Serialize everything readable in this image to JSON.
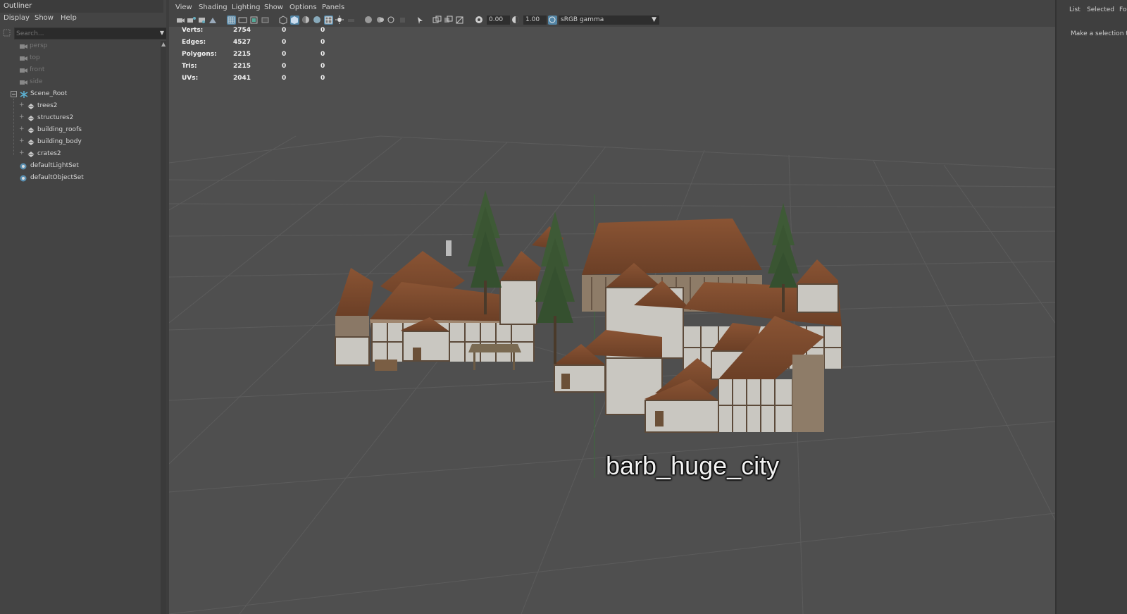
{
  "outliner": {
    "title": "Outliner",
    "menu": [
      "Display",
      "Show",
      "Help"
    ],
    "search_placeholder": "Search...",
    "items": [
      {
        "label": "persp",
        "icon": "camera-icon",
        "dim": true
      },
      {
        "label": "top",
        "icon": "camera-icon",
        "dim": true
      },
      {
        "label": "front",
        "icon": "camera-icon",
        "dim": true
      },
      {
        "label": "side",
        "icon": "camera-icon",
        "dim": true
      },
      {
        "label": "Scene_Root",
        "icon": "joint-icon",
        "dim": false
      },
      {
        "label": "trees2",
        "icon": "mesh-icon",
        "dim": false
      },
      {
        "label": "structures2",
        "icon": "mesh-icon",
        "dim": false
      },
      {
        "label": "building_roofs",
        "icon": "mesh-icon",
        "dim": false
      },
      {
        "label": "building_body",
        "icon": "mesh-icon",
        "dim": false
      },
      {
        "label": "crates2",
        "icon": "mesh-icon",
        "dim": false
      },
      {
        "label": "defaultLightSet",
        "icon": "set-icon",
        "dim": false
      },
      {
        "label": "defaultObjectSet",
        "icon": "set-icon",
        "dim": false
      }
    ]
  },
  "viewport": {
    "menu": [
      "View",
      "Shading",
      "Lighting",
      "Show",
      "Options",
      "Panels"
    ],
    "exposure": "0.00",
    "gamma_value": "1.00",
    "color_space": "sRGB gamma",
    "hud": [
      {
        "label": "Verts:",
        "v1": "2754",
        "v2": "0",
        "v3": "0"
      },
      {
        "label": "Edges:",
        "v1": "4527",
        "v2": "0",
        "v3": "0"
      },
      {
        "label": "Polygons:",
        "v1": "2215",
        "v2": "0",
        "v3": "0"
      },
      {
        "label": "Tris:",
        "v1": "2215",
        "v2": "0",
        "v3": "0"
      },
      {
        "label": "UVs:",
        "v1": "2041",
        "v2": "0",
        "v3": "0"
      }
    ],
    "scene_label": "barb_huge_city"
  },
  "right_panel": {
    "tabs": [
      "List",
      "Selected",
      "Foc"
    ],
    "hint": "Make a selection to"
  },
  "colors": {
    "accent": "#5285a6",
    "viewport_bg": "#4f4f4f",
    "panel_bg": "#444444",
    "roof": "#7b4a2e",
    "wall": "#c9c7c1",
    "tree": "#3e5a36"
  }
}
